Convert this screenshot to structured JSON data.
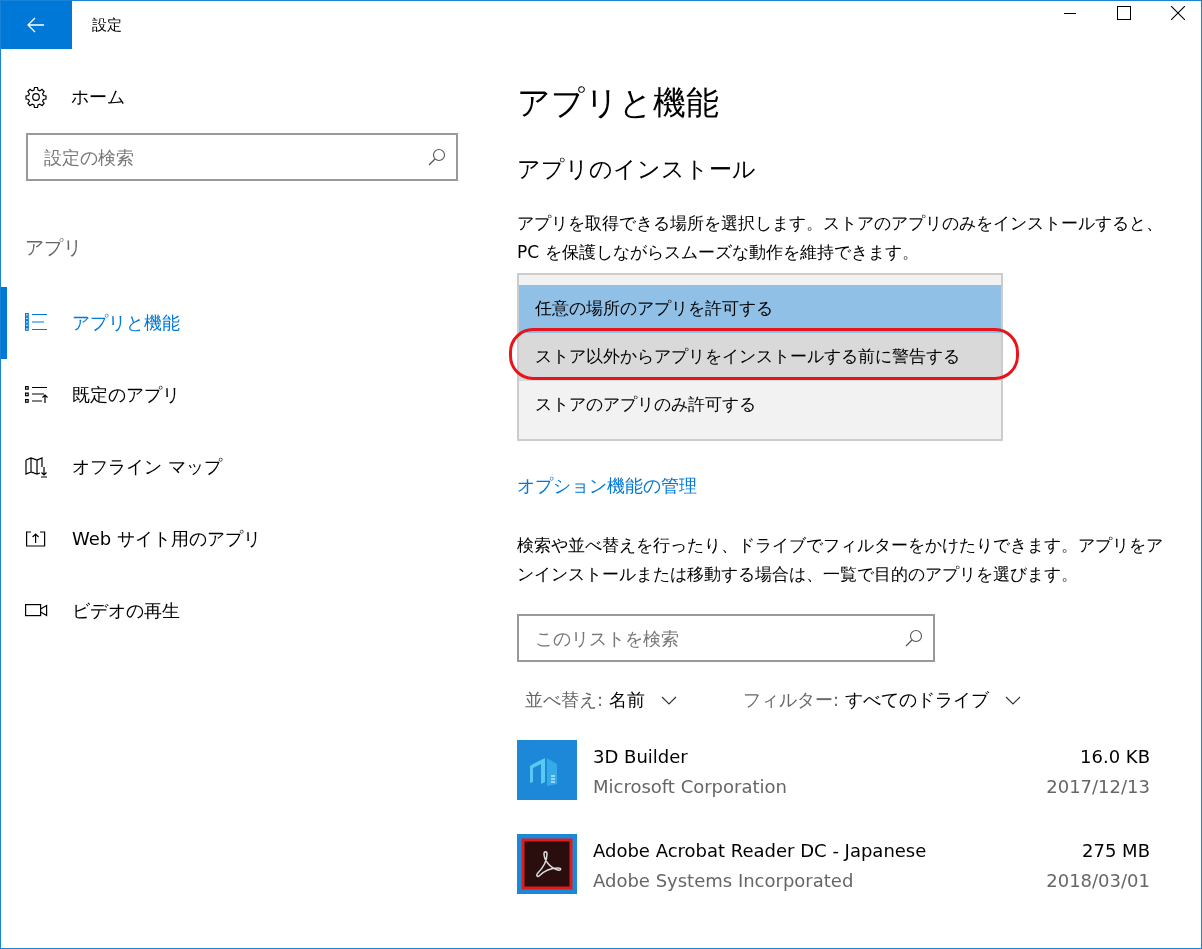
{
  "window": {
    "title": "設定"
  },
  "sidebar": {
    "home": "ホーム",
    "search": {
      "placeholder": "設定の検索"
    },
    "section": "アプリ",
    "items": [
      {
        "label": "アプリと機能",
        "selected": true
      },
      {
        "label": "既定のアプリ",
        "selected": false
      },
      {
        "label": "オフライン マップ",
        "selected": false
      },
      {
        "label": "Web サイト用のアプリ",
        "selected": false
      },
      {
        "label": "ビデオの再生",
        "selected": false
      }
    ]
  },
  "main": {
    "title": "アプリと機能",
    "install_heading": "アプリのインストール",
    "install_description": "アプリを取得できる場所を選択します。ストアのアプリのみをインストールすると、PC を保護しながらスムーズな動作を維持できます。",
    "install_options": [
      {
        "label": "任意の場所のアプリを許可する",
        "selected": true,
        "hovered": false,
        "highlighted": false
      },
      {
        "label": "ストア以外からアプリをインストールする前に警告する",
        "selected": false,
        "hovered": true,
        "highlighted": true
      },
      {
        "label": "ストアのアプリのみ許可する",
        "selected": false,
        "hovered": false,
        "highlighted": false
      }
    ],
    "optional_features_link": "オプション機能の管理",
    "list_description": "検索や並べ替えを行ったり、ドライブでフィルターをかけたりできます。アプリをアンインストールまたは移動する場合は、一覧で目的のアプリを選びます。",
    "list_search": {
      "placeholder": "このリストを検索"
    },
    "sort": {
      "label": "並べ替え:",
      "value": "名前"
    },
    "filter": {
      "label": "フィルター:",
      "value": "すべてのドライブ"
    },
    "apps": [
      {
        "name": "3D Builder",
        "publisher": "Microsoft Corporation",
        "size": "16.0 KB",
        "date": "2017/12/13"
      },
      {
        "name": "Adobe Acrobat Reader DC - Japanese",
        "publisher": "Adobe Systems Incorporated",
        "size": "275 MB",
        "date": "2018/03/01"
      }
    ]
  }
}
